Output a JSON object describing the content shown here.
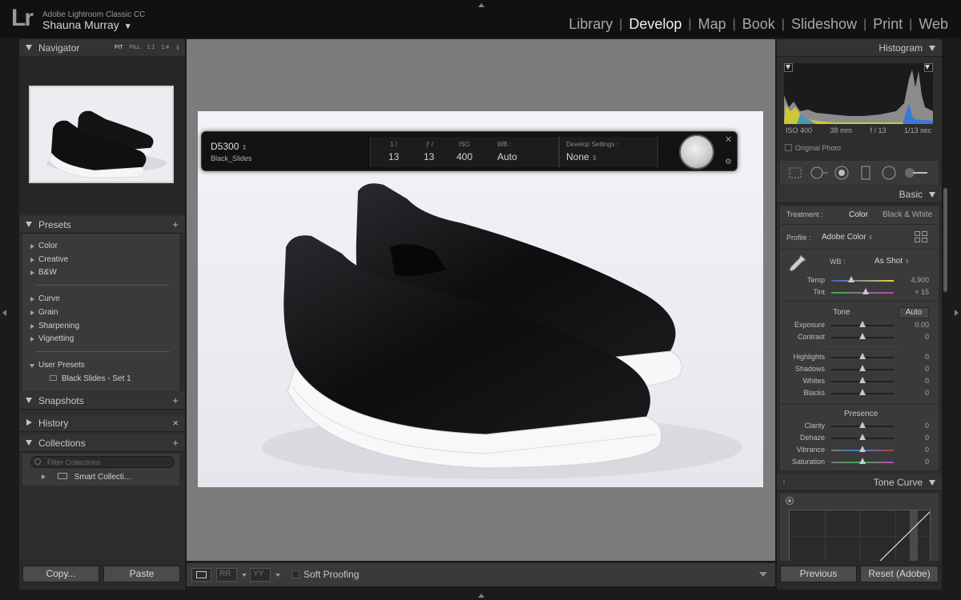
{
  "app": {
    "logo": "Lr",
    "name": "Adobe Lightroom Classic CC",
    "user": "Shauna Murray"
  },
  "modules": [
    "Library",
    "Develop",
    "Map",
    "Book",
    "Slideshow",
    "Print",
    "Web"
  ],
  "active_module": "Develop",
  "left_panel": {
    "navigator": {
      "title": "Navigator",
      "modes": [
        "FIT",
        "FILL",
        "1:1",
        "1:4"
      ]
    },
    "presets": {
      "title": "Presets",
      "add_icon": "+",
      "items": [
        "Color",
        "Creative",
        "B&W",
        "Curve",
        "Grain",
        "Sharpening",
        "Vignetting",
        "User Presets",
        "Black Slides - Set 1"
      ]
    },
    "snapshots": {
      "title": "Snapshots",
      "add_icon": "+"
    },
    "history": {
      "title": "History",
      "clear_icon": "×"
    },
    "collections": {
      "title": "Collections",
      "add_icon": "+",
      "filter_placeholder": "Filter Collections",
      "items": [
        "Smart Collecti…"
      ]
    },
    "copy_button": "Copy...",
    "paste_button": "Paste"
  },
  "hud": {
    "camera": "D5300",
    "file": "Black_Slides",
    "shutter_label": "1 /",
    "shutter_value": "13",
    "aperture_label": "ƒ /",
    "aperture_value": "13",
    "iso_label": "ISO",
    "iso_value": "400",
    "wb_label": "WB :",
    "wb_value": "Auto",
    "develop_label": "Develop Settings :",
    "develop_value": "None"
  },
  "toolbar": {
    "soft_proofing": "Soft Proofing"
  },
  "right_panel": {
    "histogram": {
      "title": "Histogram",
      "iso": "ISO 400",
      "focal": "38 mm",
      "aperture": "f / 13",
      "shutter": "1/13 sec",
      "original_photo": "Original Photo"
    },
    "basic": {
      "title": "Basic",
      "treatment_label": "Treatment :",
      "treatment_color": "Color",
      "treatment_bw": "Black & White",
      "profile_label": "Profile :",
      "profile_value": "Adobe Color",
      "wb_label": "WB :",
      "wb_value": "As Shot",
      "temp_label": "Temp",
      "temp_value": "4,900",
      "temp_level": 0.32,
      "tint_label": "Tint",
      "tint_value": "+ 15",
      "tint_level": 0.55,
      "tone_title": "Tone",
      "auto_button": "Auto",
      "exposure_label": "Exposure",
      "exposure_value": "0.00",
      "contrast_label": "Contrast",
      "contrast_value": "0",
      "highlights_label": "Highlights",
      "highlights_value": "0",
      "shadows_label": "Shadows",
      "shadows_value": "0",
      "whites_label": "Whites",
      "whites_value": "0",
      "blacks_label": "Blacks",
      "blacks_value": "0",
      "presence_title": "Presence",
      "clarity_label": "Clarity",
      "clarity_value": "0",
      "dehaze_label": "Dehaze",
      "dehaze_value": "0",
      "vibrance_label": "Vibrance",
      "vibrance_value": "0",
      "saturation_label": "Saturation",
      "saturation_value": "0"
    },
    "tone_curve": {
      "title": "Tone Curve"
    },
    "previous_button": "Previous",
    "reset_button": "Reset (Adobe)"
  },
  "colors": {
    "panel": "#2d2d2d",
    "background": "#1b1b1b",
    "center": "#7c7c7c",
    "text": "#bdbdbd"
  }
}
